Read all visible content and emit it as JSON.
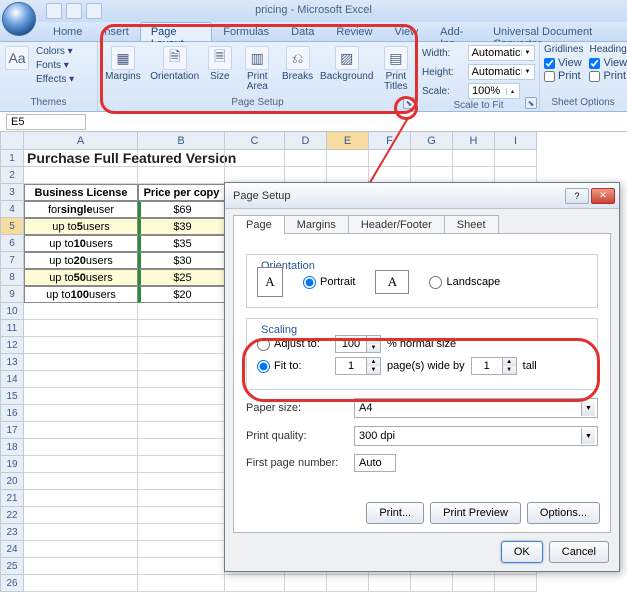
{
  "app_title": "pricing - Microsoft Excel",
  "ribbon_tabs": [
    "Home",
    "nsert",
    "Page Layout",
    "Formulas",
    "Data",
    "Review",
    "View",
    "Add-Ins",
    "Universal Document Converter"
  ],
  "active_tab": "Page Layout",
  "groups": {
    "themes": {
      "label": "Themes",
      "colors": "Colors ▾",
      "fonts": "Fonts ▾",
      "effects": "Effects ▾"
    },
    "page_setup": {
      "label": "Page Setup",
      "margins": "Margins",
      "orientation": "Orientation",
      "size": "Size",
      "print_area": "Print\nArea",
      "breaks": "Breaks",
      "background": "Background",
      "print_titles": "Print\nTitles"
    },
    "scale": {
      "label": "Scale to Fit",
      "width": "Width:",
      "height": "Height:",
      "scale": "Scale:",
      "auto": "Automatic",
      "pct": "100%"
    },
    "sheet_opts": {
      "label": "Sheet Options",
      "gridlines": "Gridlines",
      "headings": "Heading",
      "view": "View",
      "print": "Print"
    }
  },
  "name_box": "E5",
  "columns": [
    "A",
    "B",
    "C",
    "D",
    "E",
    "F",
    "G",
    "H",
    "I"
  ],
  "title_cell": "Purchase Full Featured Version",
  "headers": {
    "a": "Business License",
    "b": "Price per copy"
  },
  "data_rows": [
    {
      "a": "for single user",
      "ab": "single",
      "b": "$69"
    },
    {
      "a": "up to 5 users",
      "ab": "5",
      "b": "$39"
    },
    {
      "a": "up to 10 users",
      "ab": "10",
      "b": "$35"
    },
    {
      "a": "up to 20 users",
      "ab": "20",
      "b": "$30"
    },
    {
      "a": "up to 50 users",
      "ab": "50",
      "b": "$25"
    },
    {
      "a": "up to 100 users",
      "ab": "100",
      "b": "$20"
    }
  ],
  "dialog": {
    "title": "Page Setup",
    "tabs": [
      "Page",
      "Margins",
      "Header/Footer",
      "Sheet"
    ],
    "orientation_label": "Orientation",
    "portrait": "Portrait",
    "landscape": "Landscape",
    "scaling_label": "Scaling",
    "adjust_to": "Adjust to:",
    "adjust_val": "100",
    "pct_normal": "% normal size",
    "fit_to": "Fit to:",
    "fit_w": "1",
    "pages_wide": "page(s) wide by",
    "fit_h": "1",
    "tall": "tall",
    "paper_size": "Paper size:",
    "paper_val": "A4",
    "print_quality": "Print quality:",
    "pq_val": "300 dpi",
    "first_page": "First page number:",
    "first_val": "Auto",
    "print_btn": "Print...",
    "preview_btn": "Print Preview",
    "options_btn": "Options...",
    "ok": "OK",
    "cancel": "Cancel"
  }
}
